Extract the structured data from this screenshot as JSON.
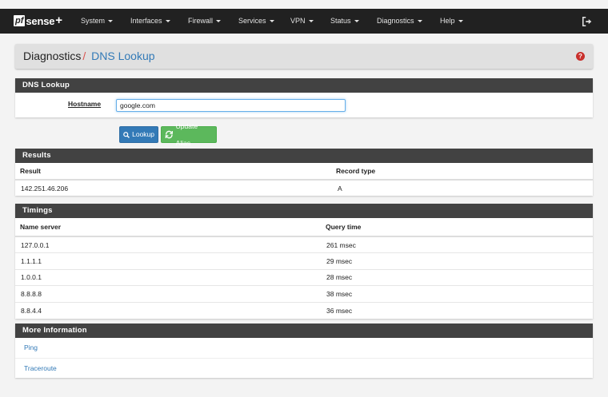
{
  "navbar": {
    "logo": {
      "pf": "pf",
      "sense": "sense",
      "plus": "+"
    },
    "menu": [
      {
        "label": "System"
      },
      {
        "label": "Interfaces"
      },
      {
        "label": "Firewall"
      },
      {
        "label": "Services"
      },
      {
        "label": "VPN"
      },
      {
        "label": "Status"
      },
      {
        "label": "Diagnostics"
      },
      {
        "label": "Help"
      }
    ],
    "logout_icon": "logout-icon"
  },
  "breadcrumb": {
    "parent": "Diagnostics",
    "separator": "/",
    "current": "DNS Lookup",
    "help_icon": "?"
  },
  "lookup_panel": {
    "title": "DNS Lookup",
    "hostname_label": "Hostname",
    "hostname_value": "google.com",
    "lookup_button": "Lookup",
    "alias_button": "Update Alias"
  },
  "results": {
    "title": "Results",
    "headers": [
      "Result",
      "Record type"
    ],
    "rows": [
      [
        "142.251.46.206",
        "A"
      ]
    ]
  },
  "timings": {
    "title": "Timings",
    "headers": [
      "Name server",
      "Query time"
    ],
    "rows": [
      [
        "127.0.0.1",
        "261 msec"
      ],
      [
        "1.1.1.1",
        "29 msec"
      ],
      [
        "1.0.0.1",
        "28 msec"
      ],
      [
        "8.8.8.8",
        "38 msec"
      ],
      [
        "8.8.4.4",
        "36 msec"
      ]
    ]
  },
  "more_info": {
    "title": "More Information",
    "links": [
      "Ping",
      "Traceroute"
    ]
  },
  "colors": {
    "navbar": "#212121",
    "panel_header": "#424242",
    "link": "#337ab7",
    "lookup_btn": "#337ab7",
    "alias_btn": "#5cb85c",
    "crumb_sep": "#d9534f"
  }
}
